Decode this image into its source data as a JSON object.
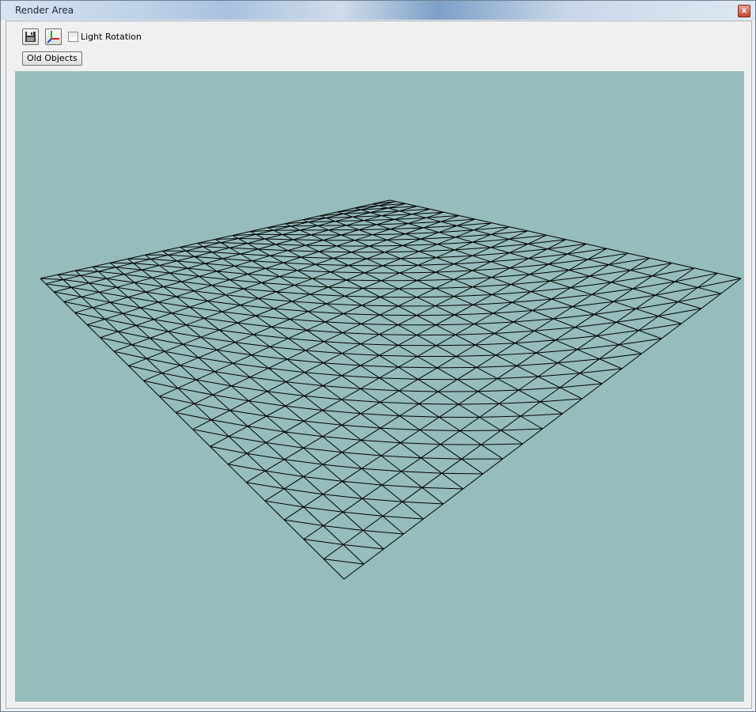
{
  "window": {
    "title": "Render Area",
    "close_glyph": "x"
  },
  "toolbar": {
    "save_icon": "floppy-disk-icon",
    "axes_icon": "xyz-axes-icon",
    "light_rotation": {
      "label": "Light Rotation",
      "checked": false
    },
    "old_objects_label": "Old Objects"
  },
  "viewport": {
    "background_color": "#96bcbc",
    "line_color": "#000000",
    "mesh": {
      "type": "triangulated wireframe grid",
      "rows": 20,
      "cols": 20
    }
  }
}
